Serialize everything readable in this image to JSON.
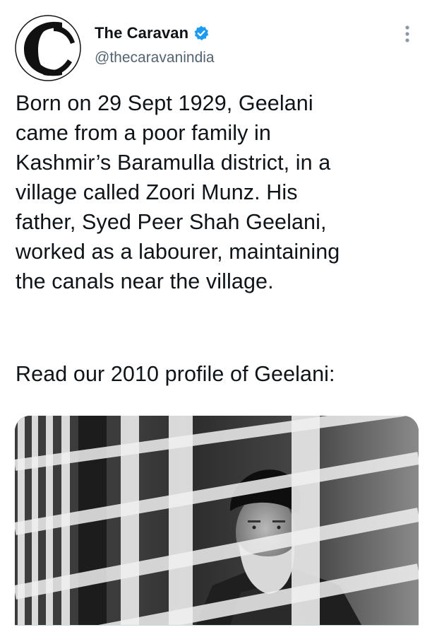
{
  "author": {
    "name": "The Caravan",
    "handle": "@thecaravanindia",
    "verified": true,
    "avatar_icon": "caravan-logo-icon"
  },
  "tweet": {
    "text": "Born on 29 Sept 1929, Geelani\ncame from a poor family in\nKashmir’s Baramulla district, in a\nvillage called Zoori Munz. His\nfather, Syed Peer Shah Geelani,\nworked as a labourer, maintaining\nthe canals near the village.",
    "text_2": "Read our 2010 profile of Geelani:"
  },
  "card": {
    "image_icon": "photo-of-man-behind-bars"
  },
  "colors": {
    "text": "#0f1419",
    "secondary": "#536471",
    "verified": "#1d9bf0"
  },
  "icons": {
    "more": "more-vertical-icon",
    "verified": "verified-badge-icon"
  }
}
